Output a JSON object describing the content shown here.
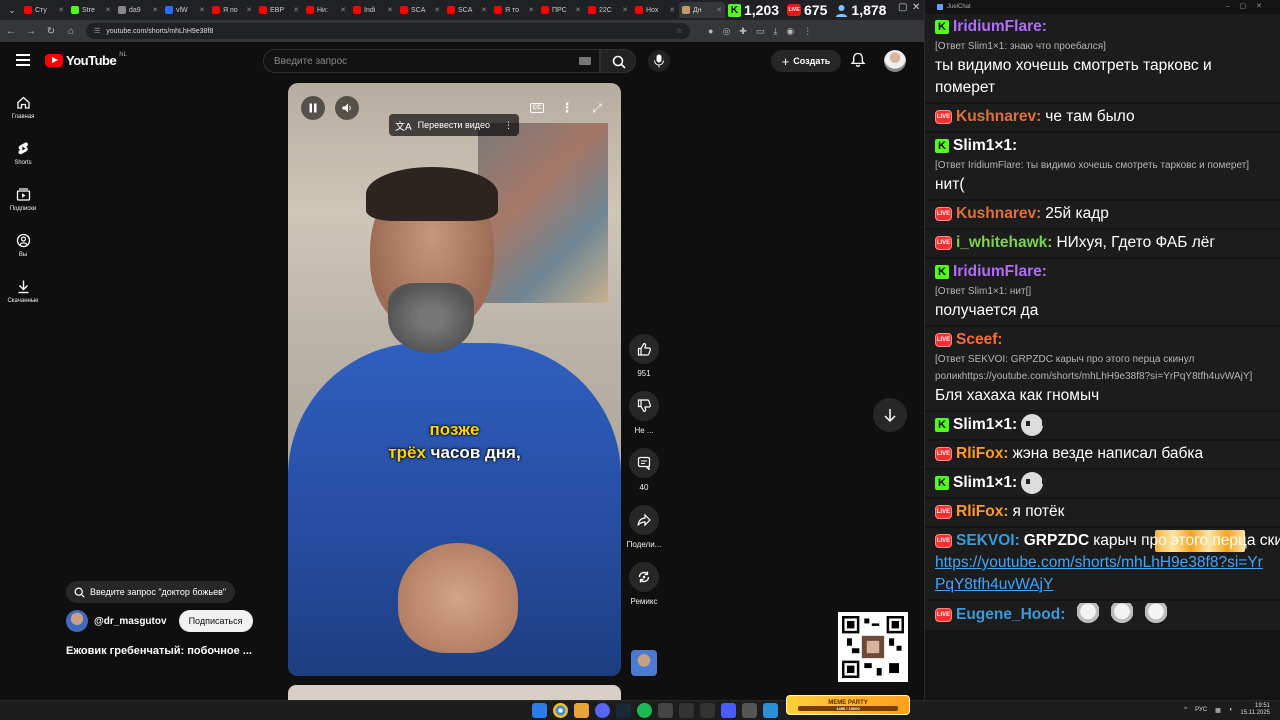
{
  "browser": {
    "tabs": [
      {
        "label": "Сту",
        "color": "#ff0000"
      },
      {
        "label": "Stre",
        "color": "#53fc18"
      },
      {
        "label": "da9",
        "color": "#888888"
      },
      {
        "label": "vlW",
        "color": "#2b6cff"
      },
      {
        "label": "Я по",
        "color": "#ff0000"
      },
      {
        "label": "EBP",
        "color": "#ff0000"
      },
      {
        "label": "Ни:",
        "color": "#ff0000"
      },
      {
        "label": "Indi",
        "color": "#ff0000"
      },
      {
        "label": "SCA",
        "color": "#ff0000"
      },
      {
        "label": "SCA",
        "color": "#ff0000"
      },
      {
        "label": "Я то",
        "color": "#ff0000"
      },
      {
        "label": "ПРС",
        "color": "#ff0000"
      },
      {
        "label": "22C",
        "color": "#ff0000"
      },
      {
        "label": "Нох",
        "color": "#ff0000"
      },
      {
        "label": "Дн",
        "color": "#c49a6c"
      }
    ],
    "url": "youtube.com/shorts/mhLhH9e38f8"
  },
  "stream_stats": {
    "kick_viewers": "1,203",
    "twitch_viewers": "675",
    "total_viewers": "1,878"
  },
  "youtube": {
    "logo_text": "YouTube",
    "region": "NL",
    "search_placeholder": "Введите запрос",
    "create_label": "Создать",
    "sidebar": [
      {
        "label": "Главная",
        "icon": "home-icon"
      },
      {
        "label": "Shorts",
        "icon": "shorts-icon"
      },
      {
        "label": "Подписки",
        "icon": "subscriptions-icon"
      },
      {
        "label": "Вы",
        "icon": "you-icon"
      },
      {
        "label": "Скачанные",
        "icon": "download-icon"
      }
    ],
    "translate_label": "Перевести видео",
    "subtitle_highlight": "позже",
    "subtitle_line2_highlight": "трёх",
    "subtitle_line2_rest": "часов дня,",
    "actions": [
      {
        "label": "951",
        "icon": "like-icon"
      },
      {
        "label": "Не ...",
        "icon": "dislike-icon"
      },
      {
        "label": "40",
        "icon": "comment-icon"
      },
      {
        "label": "Подели...",
        "icon": "share-icon"
      },
      {
        "label": "Ремикс",
        "icon": "remix-icon"
      }
    ],
    "search_hint": "Введите запрос \"доктор божьев\"",
    "channel": "@dr_masgutov",
    "subscribe_label": "Подписаться",
    "video_title": "Ежовик гребенчатый: побочное ..."
  },
  "chat": {
    "title": "JuelChat",
    "messages": [
      {
        "platform": "kick",
        "user": "IridiumFlare:",
        "color": "#b16cff",
        "reply": "[Ответ Slim1×1: знаю что проебался]",
        "text": "ты видимо хочешь смотреть тарковс и померет"
      },
      {
        "platform": "twitch",
        "user": "Kushnarev:",
        "color": "#e0703a",
        "text": "че там было"
      },
      {
        "platform": "kick",
        "user": "Slim1×1:",
        "color": "#ffffff",
        "reply": "[Ответ IridiumFlare: ты видимо хочешь смотреть тарковс и померет]",
        "text": "нит("
      },
      {
        "platform": "twitch",
        "user": "Kushnarev:",
        "color": "#e0703a",
        "text": "25й кадр"
      },
      {
        "platform": "twitch",
        "user": "i_whitehawk:",
        "color": "#7fd14f",
        "text": "НИхуя, Гдето ФАБ лёг"
      },
      {
        "platform": "kick",
        "user": "IridiumFlare:",
        "color": "#b16cff",
        "reply": "[Ответ Slim1×1: нит[]",
        "text": "получается да"
      },
      {
        "platform": "twitch",
        "user": "Sceef:",
        "color": "#ff6b3a",
        "reply": "[Ответ SEKVOI: GRPZDC карыч про этого перца скинул роликhttps://youtube.com/shorts/mhLhH9e38f8?si=YrPqY8tfh4uvWAjY]",
        "text": "Бля хахаха как гномыч"
      },
      {
        "platform": "kick",
        "user": "Slim1×1:",
        "color": "#ffffff",
        "text": "",
        "emote": "pog-emote"
      },
      {
        "platform": "twitch",
        "user": "RliFox:",
        "color": "#ff9a2a",
        "text": "жэна везде написал бабка"
      },
      {
        "platform": "kick",
        "user": "Slim1×1:",
        "color": "#ffffff",
        "text": "",
        "emote": "pog-emote"
      },
      {
        "platform": "twitch",
        "user": "RliFox:",
        "color": "#ff9a2a",
        "text": "я потёк"
      },
      {
        "platform": "twitch",
        "user": "SEKVOI:",
        "color": "#3a9bdc",
        "text_bold": "GRPZDC",
        "text": "карыч про этого перца скинул ролик",
        "link": "https://youtube.com/shorts/mhLhH9e38f8?si=YrPqY8tfh4uvWAjY"
      },
      {
        "platform": "twitch",
        "user": "Eugene_Hood:",
        "color": "#3a9bdc",
        "text": "",
        "emote": "cat-emote"
      }
    ]
  },
  "taskbar": {
    "widget_title": "MEME PARTY",
    "widget_progress": "1456 / 15000",
    "language": "РУС",
    "time": "19:51",
    "date": "15.11.2025"
  }
}
